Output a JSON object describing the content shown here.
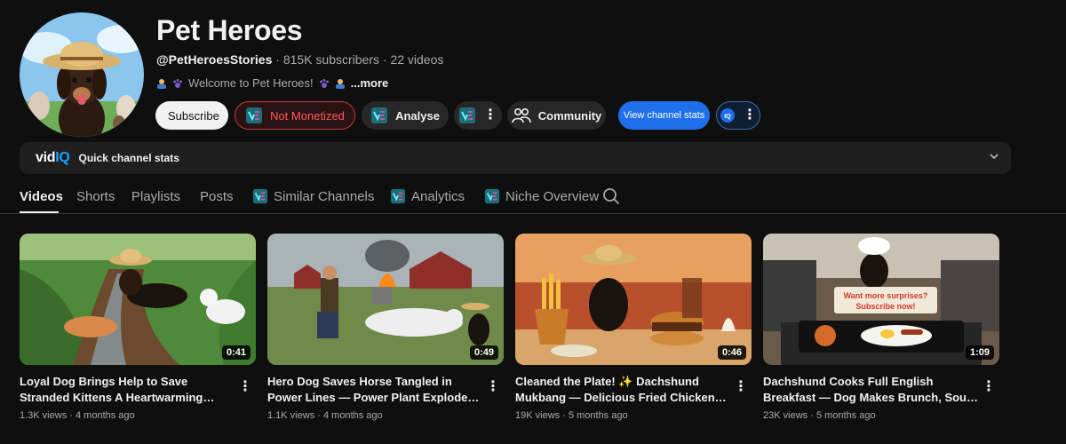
{
  "channel": {
    "name": "Pet Heroes",
    "handle": "@PetHeroesStories",
    "subscribers": "815K subscribers",
    "videos_count": "22 videos",
    "separator": "·",
    "description": "Welcome to Pet Heroes!",
    "more": "...more"
  },
  "actions": {
    "subscribe": "Subscribe",
    "not_monetized": "Not Monetized",
    "analyse": "Analyse",
    "community": "Community",
    "view_stats": "View channel stats",
    "iq": "IQ"
  },
  "quick_stats": {
    "logo_a": "vid",
    "logo_b": "IQ",
    "label": "Quick channel stats"
  },
  "tabs": [
    {
      "label": "Videos"
    },
    {
      "label": "Shorts"
    },
    {
      "label": "Playlists"
    },
    {
      "label": "Posts"
    },
    {
      "label": "Similar Channels"
    },
    {
      "label": "Analytics"
    },
    {
      "label": "Niche Overview"
    }
  ],
  "videos": [
    {
      "title": "Loyal Dog Brings Help to Save Stranded Kittens A Heartwarming Rescue Story",
      "views": "1.3K views",
      "age": "4 months ago",
      "duration": "0:41"
    },
    {
      "title": "Hero Dog Saves Horse Tangled in Power Lines — Power Plant Explodes! #shorts...",
      "views": "1.1K views",
      "age": "4 months ago",
      "duration": "0:49"
    },
    {
      "title": "Cleaned the Plate! ✨ Dachshund Mukbang — Delicious Fried Chicken Legs, Burgers, Ic...",
      "views": "19K views",
      "age": "5 months ago",
      "duration": "0:46"
    },
    {
      "title": "Dachshund Cooks Full English Breakfast — Dog Makes Brunch, Soup & Coffee...",
      "views": "23K views",
      "age": "5 months ago",
      "duration": "1:09"
    }
  ],
  "thumb_text": {
    "sign_1": "Want more surprises?",
    "sign_2": "Subscribe now!"
  },
  "colors": {
    "background": "#0f0f0f",
    "accent_blue": "#1f6feb",
    "not_monetized": "#ff5b5b"
  }
}
